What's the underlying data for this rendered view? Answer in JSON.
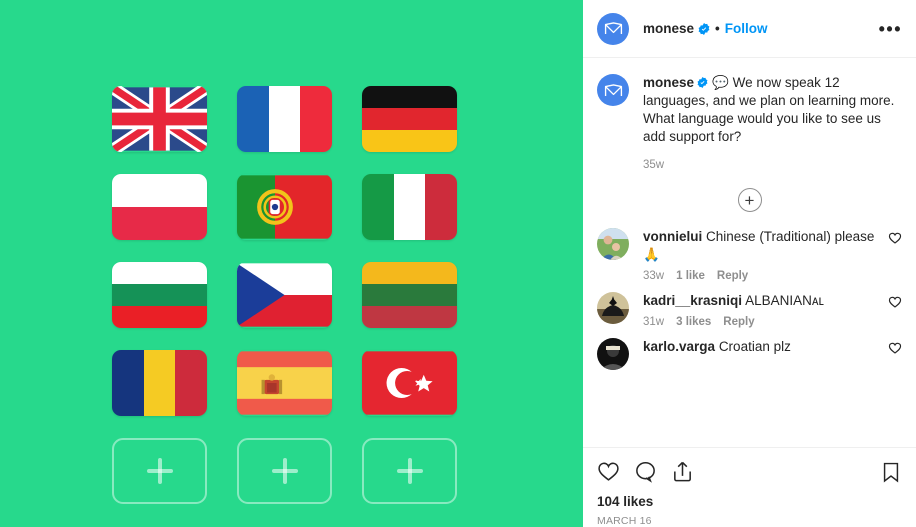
{
  "post": {
    "header": {
      "username": "monese",
      "verified_icon": "verified-badge-icon",
      "separator": "•",
      "follow_label": "Follow",
      "more_label": "•••"
    },
    "caption": {
      "username": "monese",
      "text": "We now speak 12 languages, and we plan on learning more. What language would you like to see us add support for?",
      "emoji": "💬",
      "time": "35w"
    },
    "load_more_label": "+",
    "comments": [
      {
        "username": "vonnielui",
        "text": "Chinese (Traditional) please 🙏",
        "time": "33w",
        "likes": "1 like",
        "reply": "Reply",
        "avatar_kind": "photo-couple"
      },
      {
        "username": "kadri__krasniqi",
        "text": "ALBANIANᴀʟ",
        "time": "31w",
        "likes": "3 likes",
        "reply": "Reply",
        "avatar_kind": "photo-eagle"
      },
      {
        "username": "karlo.varga",
        "text": "Croatian plz",
        "time": "",
        "likes": "",
        "reply": "",
        "avatar_kind": "photo-dark"
      }
    ],
    "actions": {
      "like_icon": "heart-icon",
      "comment_icon": "comment-bubble-icon",
      "share_icon": "share-icon",
      "save_icon": "bookmark-icon",
      "likes_count": "104 likes",
      "date": "MARCH 16"
    }
  },
  "media": {
    "background_color": "#27d98c",
    "tiles": [
      {
        "name": "united-kingdom",
        "type": "flag"
      },
      {
        "name": "france",
        "type": "flag"
      },
      {
        "name": "germany",
        "type": "flag"
      },
      {
        "name": "poland",
        "type": "flag"
      },
      {
        "name": "portugal",
        "type": "flag"
      },
      {
        "name": "italy",
        "type": "flag"
      },
      {
        "name": "bulgaria",
        "type": "flag"
      },
      {
        "name": "czech-republic",
        "type": "flag"
      },
      {
        "name": "lithuania",
        "type": "flag"
      },
      {
        "name": "romania",
        "type": "flag"
      },
      {
        "name": "spain",
        "type": "flag"
      },
      {
        "name": "turkey",
        "type": "flag"
      },
      {
        "name": "placeholder-1",
        "type": "placeholder"
      },
      {
        "name": "placeholder-2",
        "type": "placeholder"
      },
      {
        "name": "placeholder-3",
        "type": "placeholder"
      }
    ]
  }
}
